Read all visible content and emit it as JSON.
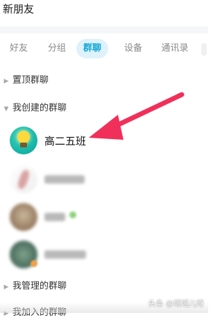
{
  "header": {
    "title": "新朋友"
  },
  "tabs": [
    {
      "label": "好友"
    },
    {
      "label": "分组"
    },
    {
      "label": "群聊",
      "active": true
    },
    {
      "label": "设备"
    },
    {
      "label": "通讯录"
    }
  ],
  "sections": {
    "pinned": {
      "label": "置顶群聊",
      "expanded": false
    },
    "created": {
      "label": "我创建的群聊",
      "expanded": true
    },
    "managed": {
      "label": "我管理的群聊",
      "expanded": false
    },
    "joined": {
      "label": "我加入的群聊",
      "expanded": false
    }
  },
  "groups": [
    {
      "name": "高二五班",
      "avatar_icon": "lightbulb-icon"
    },
    {
      "name": "",
      "avatar_icon": "doodle-avatar"
    },
    {
      "name": "",
      "avatar_icon": "photo-avatar"
    },
    {
      "name": "",
      "avatar_icon": "photo-avatar"
    }
  ],
  "annotation": {
    "arrow_color": "#f0305a"
  },
  "colors": {
    "accent": "#12a7d6",
    "tab_active_bg": "#dff2fb",
    "avatar_teal": "#19b6a9"
  },
  "watermark": "头条 @瑶瑶儿呀"
}
